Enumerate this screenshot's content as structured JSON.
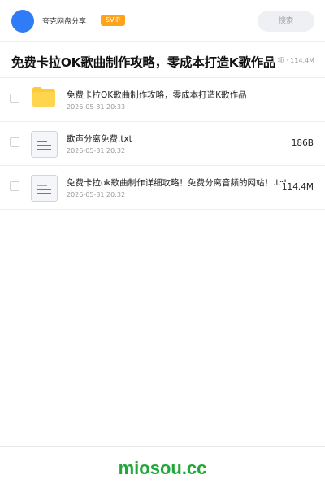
{
  "header": {
    "brand": "夸克网盘分享",
    "badge": "SVIP",
    "search_placeholder": "搜索"
  },
  "share": {
    "title": "免费卡拉OK歌曲制作攻略，零成本打造K歌作品",
    "summary": "1 项 · 114.4M"
  },
  "files": [
    {
      "type": "folder",
      "name": "免费卡拉OK歌曲制作攻略，零成本打造K歌作品",
      "date": "2026-05-31 20:33",
      "size": ""
    },
    {
      "type": "file",
      "name": "歌声分离免费.txt",
      "date": "2026-05-31 20:32",
      "size": "186B"
    },
    {
      "type": "file",
      "name": "免费卡拉ok歌曲制作详细攻略！免费分离音频的网站！.txt",
      "date": "2026-05-31 20:32",
      "size": "114.4M"
    }
  ],
  "footer": {
    "watermark": "miosou.cc"
  },
  "colors": {
    "accent": "#2f7cf6",
    "badge": "#ffa31a",
    "folder": "#ffc93a",
    "watermark": "#22a83a"
  }
}
